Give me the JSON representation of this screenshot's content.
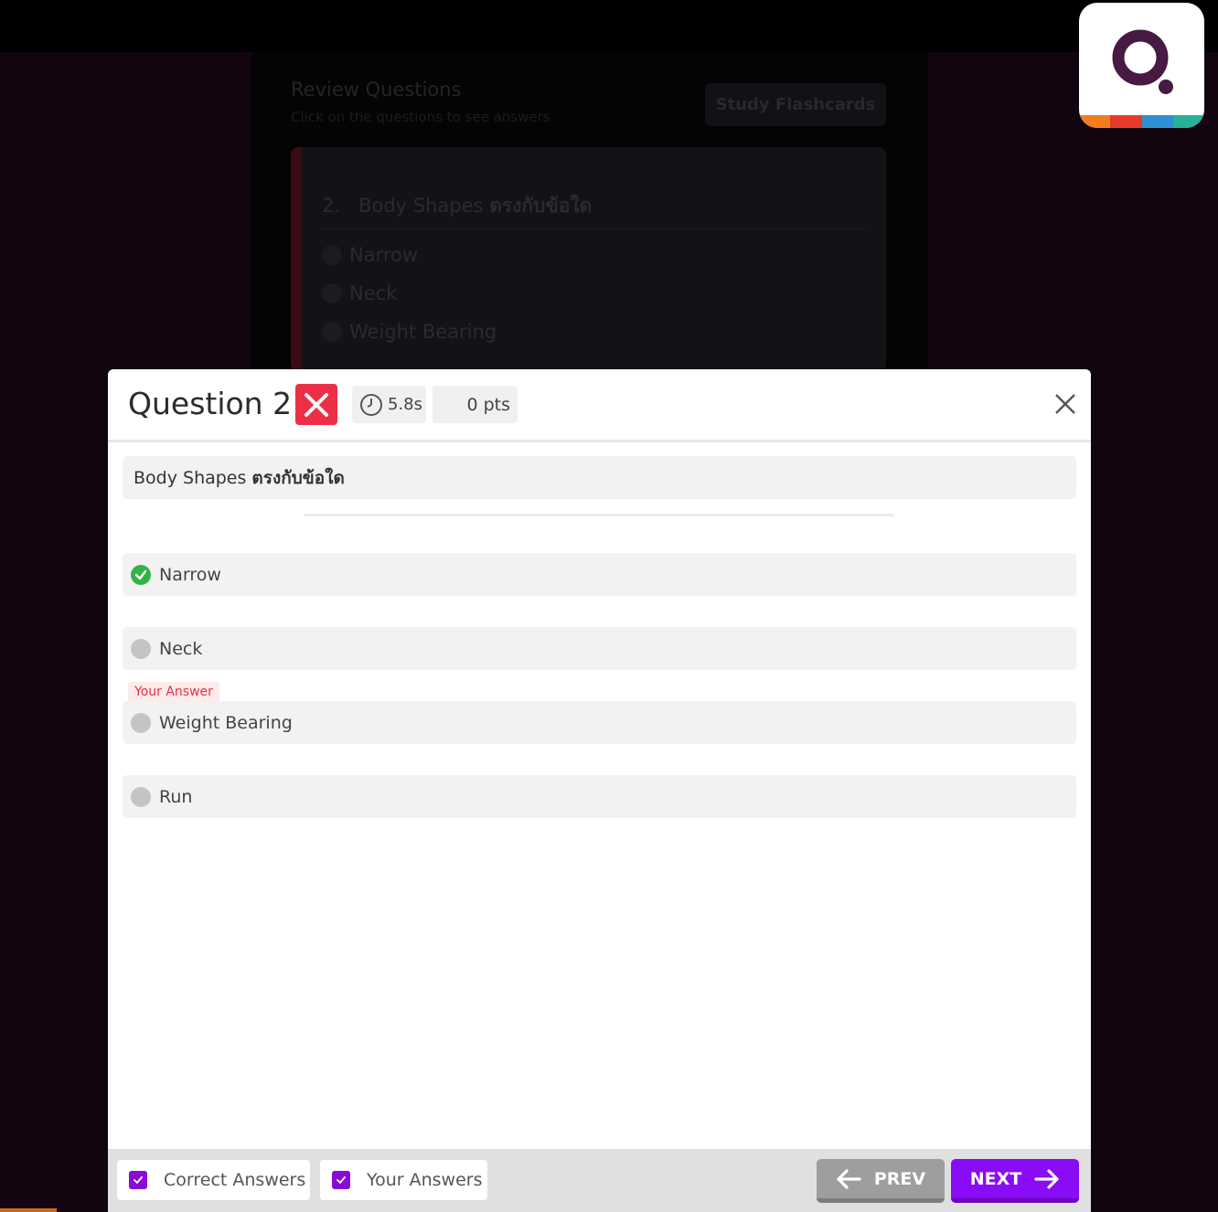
{
  "background": {
    "title": "Review Questions",
    "subtitle": "Click on the questions to see answers",
    "flashcards_label": "Study Flashcards",
    "card": {
      "number": "2.",
      "question_text": "Body Shapes",
      "question_thai": "ตรงกับข้อใด",
      "options": [
        "Narrow",
        "Neck",
        "Weight Bearing"
      ]
    }
  },
  "logo": {
    "letter": "Q",
    "strip_colors": [
      "#f47c20",
      "#e8392d",
      "#2f8fd4",
      "#26b19a"
    ]
  },
  "modal": {
    "title": "Question 2",
    "status": "incorrect",
    "time": "5.8s",
    "points": "0 pts",
    "question_text": "Body Shapes",
    "question_thai": "ตรงกับข้อใด",
    "options": [
      {
        "label": "Narrow",
        "correct": true
      },
      {
        "label": "Neck",
        "correct": false
      },
      {
        "label": "Weight Bearing",
        "correct": false,
        "your_answer": true
      },
      {
        "label": "Run",
        "correct": false
      }
    ],
    "your_answer_tag": "Your Answer"
  },
  "footer": {
    "correct_answers_label": "Correct Answers",
    "correct_answers_checked": true,
    "your_answers_label": "Your Answers",
    "your_answers_checked": true,
    "prev_label": "PREV",
    "next_label": "NEXT"
  },
  "colors": {
    "accent_purple": "#8a0bf5",
    "wrong_red": "#ec2f47",
    "correct_green": "#33b24a",
    "logo_purple": "#461a42"
  }
}
